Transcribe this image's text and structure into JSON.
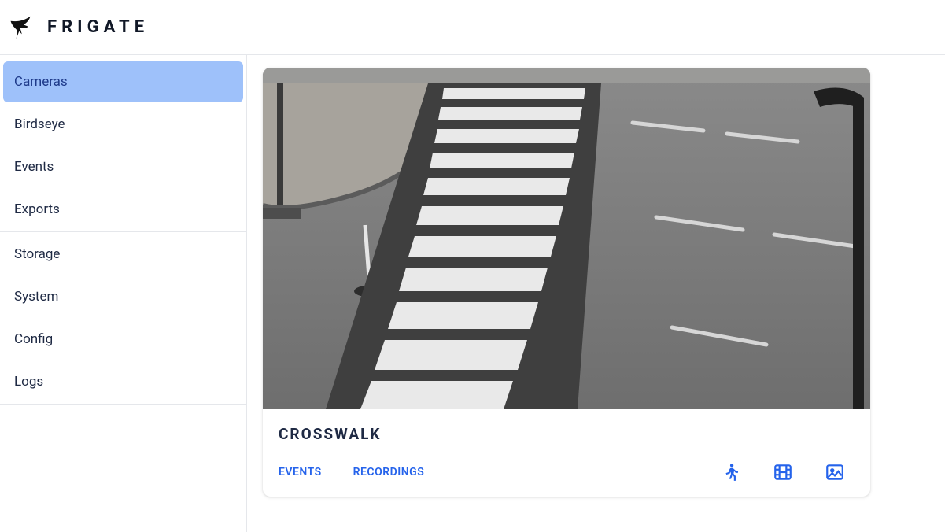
{
  "app": {
    "name": "FRIGATE"
  },
  "sidebar": {
    "group1": [
      {
        "label": "Cameras",
        "active": true
      },
      {
        "label": "Birdseye",
        "active": false
      },
      {
        "label": "Events",
        "active": false
      },
      {
        "label": "Exports",
        "active": false
      }
    ],
    "group2": [
      {
        "label": "Storage"
      },
      {
        "label": "System"
      },
      {
        "label": "Config"
      },
      {
        "label": "Logs"
      }
    ]
  },
  "camera_card": {
    "title": "CROSSWALK",
    "links": {
      "events": "EVENTS",
      "recordings": "RECORDINGS"
    },
    "icons": {
      "person": "person-walking-icon",
      "film": "film-icon",
      "image": "image-icon"
    }
  }
}
